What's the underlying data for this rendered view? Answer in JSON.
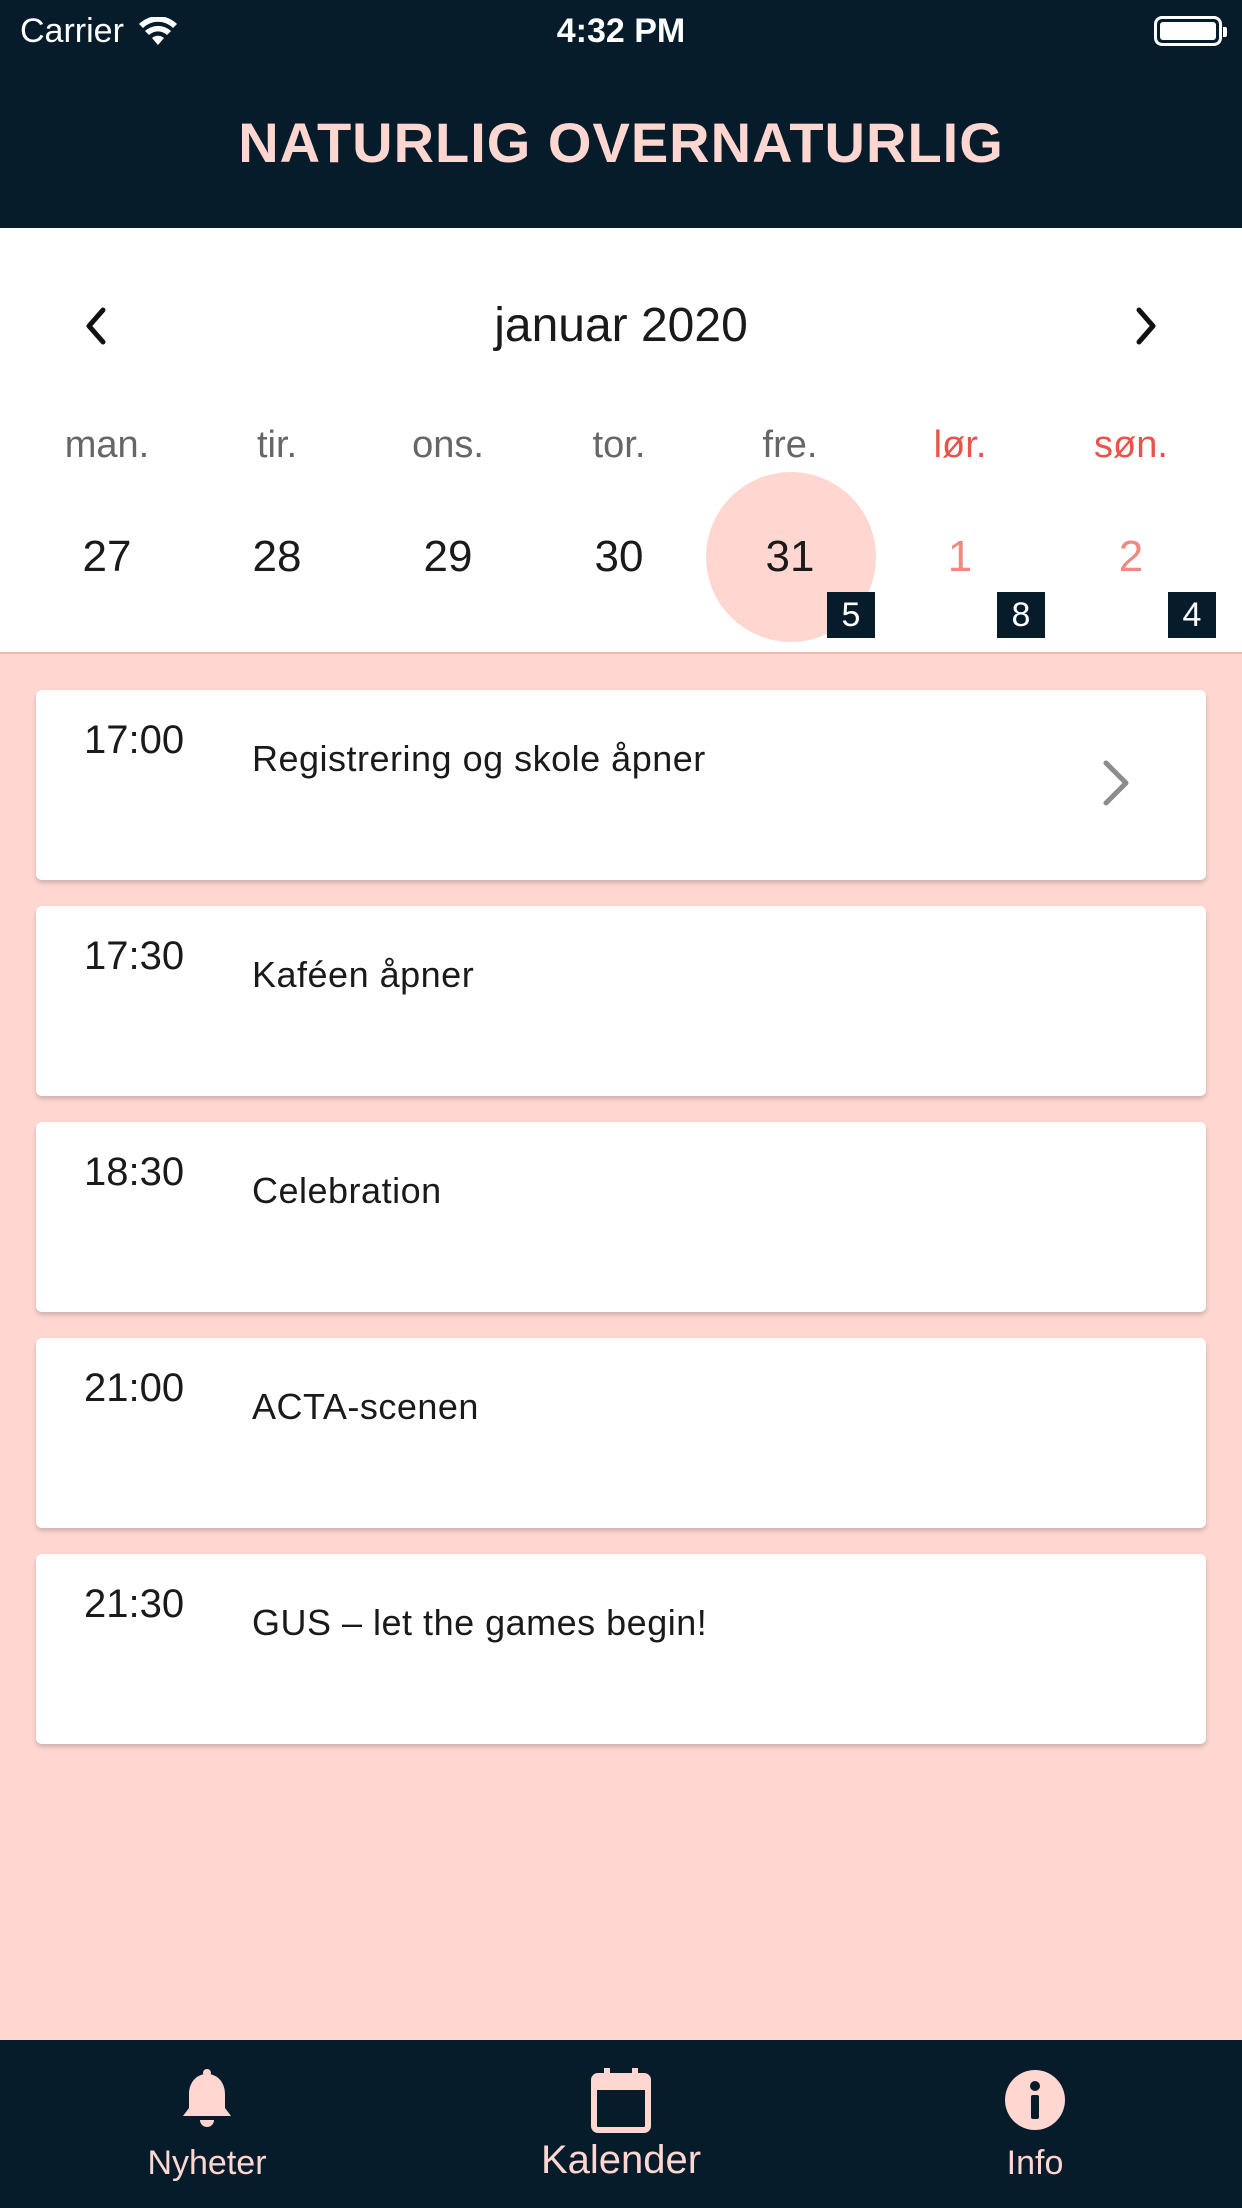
{
  "status_bar": {
    "carrier": "Carrier",
    "time": "4:32 PM"
  },
  "header": {
    "title": "NATURLIG OVERNATURLIG"
  },
  "calendar": {
    "month_label": "januar 2020",
    "weekdays": [
      {
        "label": "man.",
        "weekend": false
      },
      {
        "label": "tir.",
        "weekend": false
      },
      {
        "label": "ons.",
        "weekend": false
      },
      {
        "label": "tor.",
        "weekend": false
      },
      {
        "label": "fre.",
        "weekend": false
      },
      {
        "label": "lør.",
        "weekend": true
      },
      {
        "label": "søn.",
        "weekend": true
      }
    ],
    "days": [
      {
        "num": "27",
        "badge": ""
      },
      {
        "num": "28",
        "badge": ""
      },
      {
        "num": "29",
        "badge": ""
      },
      {
        "num": "30",
        "badge": ""
      },
      {
        "num": "31",
        "badge": "5",
        "selected": true
      },
      {
        "num": "1",
        "badge": "8"
      },
      {
        "num": "2",
        "badge": "4"
      }
    ]
  },
  "events": [
    {
      "time": "17:00",
      "title": "Registrering og skole åpner",
      "has_detail": true
    },
    {
      "time": "17:30",
      "title": "Kaféen åpner",
      "has_detail": false
    },
    {
      "time": "18:30",
      "title": "Celebration",
      "has_detail": false
    },
    {
      "time": "21:00",
      "title": "ACTA-scenen",
      "has_detail": false
    },
    {
      "time": "21:30",
      "title": "GUS – let the games begin!",
      "has_detail": false
    }
  ],
  "tabbar": {
    "tabs": [
      {
        "label": "Nyheter",
        "icon": "bell-icon"
      },
      {
        "label": "Kalender",
        "icon": "calendar-icon",
        "active": true
      },
      {
        "label": "Info",
        "icon": "info-icon"
      }
    ]
  },
  "colors": {
    "header_bg": "#061c2b",
    "accent_pink": "#ffd6d0",
    "weekend_red": "#e8544a"
  }
}
